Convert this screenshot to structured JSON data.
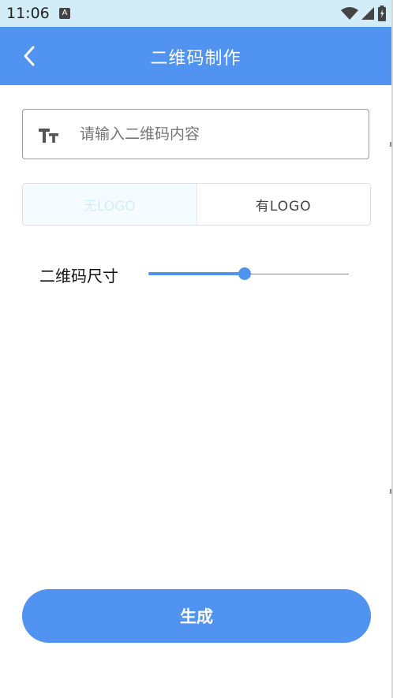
{
  "status_bar": {
    "time": "11:06",
    "notification_icon": "a-icon",
    "notification_letter": "A",
    "icons": [
      "wifi-icon",
      "signal-icon",
      "battery-icon"
    ]
  },
  "header": {
    "title": "二维码制作",
    "back_icon": "chevron-left-icon"
  },
  "content_input": {
    "icon": "text-format-icon",
    "value": "",
    "placeholder": "请输入二维码内容"
  },
  "logo_toggle": {
    "options": [
      {
        "label": "无LOGO",
        "selected": true
      },
      {
        "label": "有LOGO",
        "selected": false
      }
    ]
  },
  "size_slider": {
    "label": "二维码尺寸",
    "value": 0.48
  },
  "generate_button": {
    "label": "生成"
  },
  "colors": {
    "primary": "#5093f0",
    "status_bar": "#d2ecf8",
    "selected_option_text": "#cfeefa",
    "option_text": "#444444"
  }
}
